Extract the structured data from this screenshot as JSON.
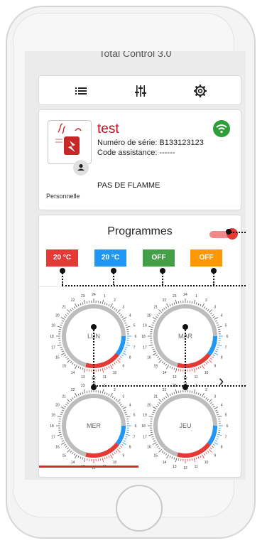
{
  "app": {
    "title": "Total Control 3.0"
  },
  "toolbar": {
    "items": [
      {
        "name": "list-icon"
      },
      {
        "name": "sliders-icon"
      },
      {
        "name": "gear-icon"
      }
    ]
  },
  "device": {
    "name": "test",
    "serial": "Numéro de série: B133123123",
    "assistance": "Code assistance: ------",
    "status": "PAS DE FLAMME",
    "mode": "Personnelle",
    "wifi_color": "#2e9d3a"
  },
  "programmes": {
    "title": "Programmes",
    "toggle_on": true,
    "pills": [
      {
        "label": "20 °C",
        "color": "#e53935"
      },
      {
        "label": "20 °C",
        "color": "#2196f3"
      },
      {
        "label": "OFF",
        "color": "#43a047"
      },
      {
        "label": "OFF",
        "color": "#ff9800"
      }
    ],
    "next_label": "›",
    "dials": [
      {
        "day": "LUN"
      },
      {
        "day": "MAR"
      },
      {
        "day": "MER"
      },
      {
        "day": "JEU"
      }
    ]
  }
}
